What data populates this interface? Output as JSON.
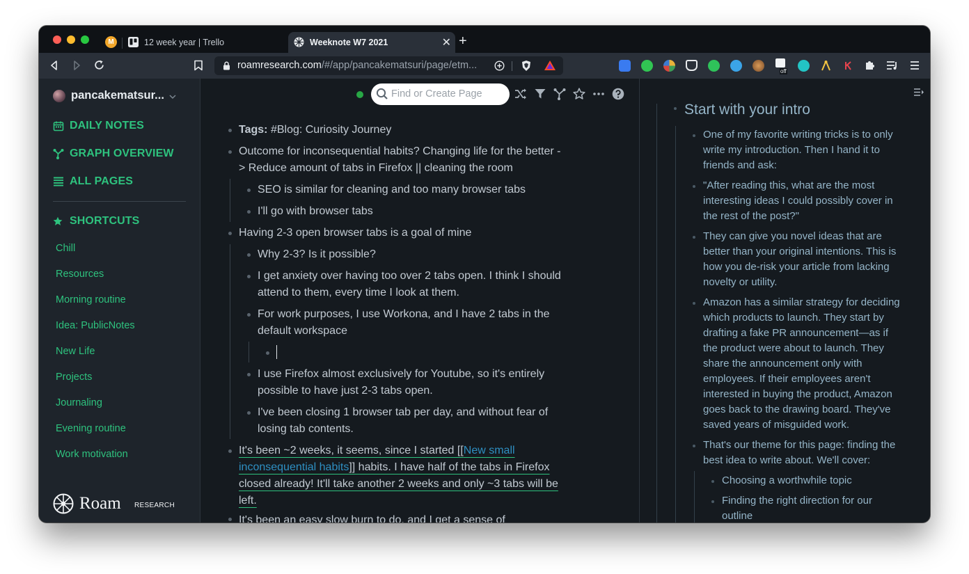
{
  "browser": {
    "profile_initial": "M",
    "tabs": [
      {
        "title": "12 week year | Trello",
        "active": false
      },
      {
        "title": "Weeknote W7 2021",
        "active": true
      }
    ],
    "close_glyph": "✕",
    "newtab_glyph": "+",
    "url_host": "roamresearch.com",
    "url_path": "/#/app/pancakematsuri/page/etm...",
    "extension_badge": "off"
  },
  "sidebar": {
    "graph_name": "pancakematsur...",
    "nav": [
      {
        "label": "DAILY NOTES",
        "icon": "calendar-icon"
      },
      {
        "label": "GRAPH OVERVIEW",
        "icon": "graph-icon"
      },
      {
        "label": "ALL PAGES",
        "icon": "list-icon"
      }
    ],
    "shortcuts_title": "SHORTCUTS",
    "shortcuts": [
      "Chill",
      "Resources",
      "Morning routine",
      "Idea: PublicNotes",
      "New Life",
      "Projects",
      "Journaling",
      "Evening routine",
      "Work motivation"
    ],
    "logo_word": "Roam",
    "logo_sub": "RESEARCH"
  },
  "topbar": {
    "search_placeholder": "Find or Create Page",
    "status_color": "#28a745"
  },
  "main": {
    "tags_label": "Tags:",
    "tags_value": "#Blog: Curiosity Journey",
    "b2_l1": "Outcome for inconsequential habits? Changing life for the better -",
    "b2_l2": "> Reduce amount of tabs in Firefox || cleaning the room",
    "b2a": "SEO is similar for cleaning and too many browser tabs",
    "b2b": "I'll go with browser tabs",
    "b3": "Having 2-3 open browser tabs is a goal of mine",
    "b3a": "Why 2-3? Is it possible?",
    "b3b_l1": "I get anxiety over having too over 2 tabs open. I think I should",
    "b3b_l2": "attend to them, every time I look at them.",
    "b3c_l1": "For work purposes, I use Workona, and I have 2 tabs in the",
    "b3c_l2": "default workspace",
    "b3d_l1": "I use Firefox almost exclusively for Youtube, so it's entirely",
    "b3d_l2": "possible to have just 2-3 tabs open.",
    "b3e_l1": "I've been closing 1 browser tab per day, and without fear of",
    "b3e_l2": "losing tab contents.",
    "b4_l1_pre": "It's been ~2 weeks, it seems, since I started [[",
    "b4_ref1": "New small",
    "b4_ref2": "inconsequential habits",
    "b4_l2_post": "]] habits. I have half of the tabs in Firefox",
    "b4_l3": "closed already! It'll take another 2 weeks and only ~3 tabs will be",
    "b4_l4": "left.",
    "b5": "It's been an easy slow burn to do, and I get a sense of"
  },
  "right": {
    "title": "Start with your intro",
    "r1": [
      "One of my favorite writing tricks is to only",
      "write my introduction. Then I hand it to",
      "friends and ask:"
    ],
    "r2": [
      "\"After reading this, what are the most",
      "interesting ideas I could possibly cover in",
      "the rest of the post?\""
    ],
    "r3": [
      "They can give you novel ideas that are",
      "better than your original intentions. This is",
      "how you de-risk your article from lacking",
      "novelty or utility."
    ],
    "r4": [
      "Amazon has a similar strategy for deciding",
      "which products to launch. They start by",
      "drafting a fake PR announcement—as if",
      "the product were about to launch. They",
      "share the announcement only with",
      "employees. If their employees aren't",
      "interested in buying the product, Amazon",
      "goes back to the drawing board. They've",
      "saved years of misguided work."
    ],
    "r5": [
      "That's our theme for this page: finding the",
      "best idea to write about. We'll cover:"
    ],
    "r5a": "Choosing a worthwhile topic",
    "r5b": [
      "Finding the right direction for our",
      "outline"
    ]
  }
}
